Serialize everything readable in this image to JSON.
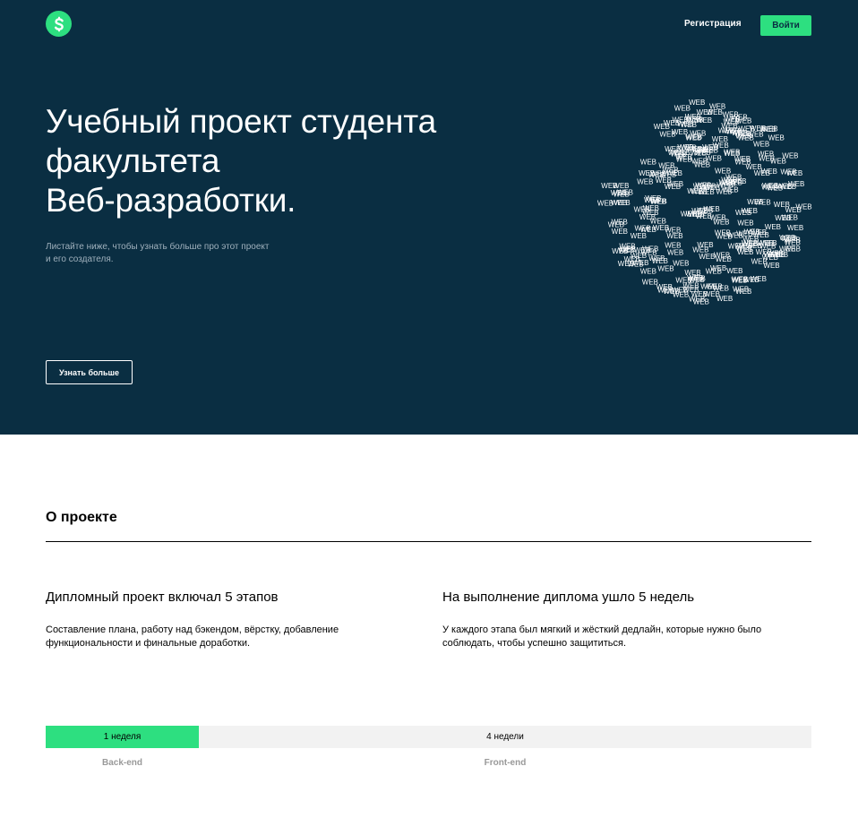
{
  "header": {
    "logo_icon": "dollar-s-logo-icon",
    "register_label": "Регистрация",
    "login_label": "Войти"
  },
  "hero": {
    "title_lines": [
      "Учебный проект студента",
      "факультета",
      "Веб-разработки."
    ],
    "subtitle": "Листайте ниже, чтобы узнать больше про этот проект и его создателя.",
    "button_label": "Узнать больше",
    "logo_word": "WEB"
  },
  "about": {
    "title": "О проекте",
    "left": {
      "heading": "Дипломный проект включал 5 этапов",
      "text": "Составление плана, работу над бэкендом, вёрстку, добавление функциональности и финальные доработки."
    },
    "right": {
      "heading": "На выполнение диплома ушло 5 недель",
      "text": "У каждого этапа был мягкий и жёсткий дедлайн, которые нужно было соблюдать, чтобы успешно защититься."
    }
  },
  "timeline": {
    "segments": [
      {
        "value": "1 неделя",
        "label": "Back-end"
      },
      {
        "value": "4 недели",
        "label": "Front-end"
      }
    ]
  },
  "colors": {
    "hero_bg": "#0a2e42",
    "accent": "#2ddf80",
    "timeline_bg": "#f2f2f2"
  }
}
